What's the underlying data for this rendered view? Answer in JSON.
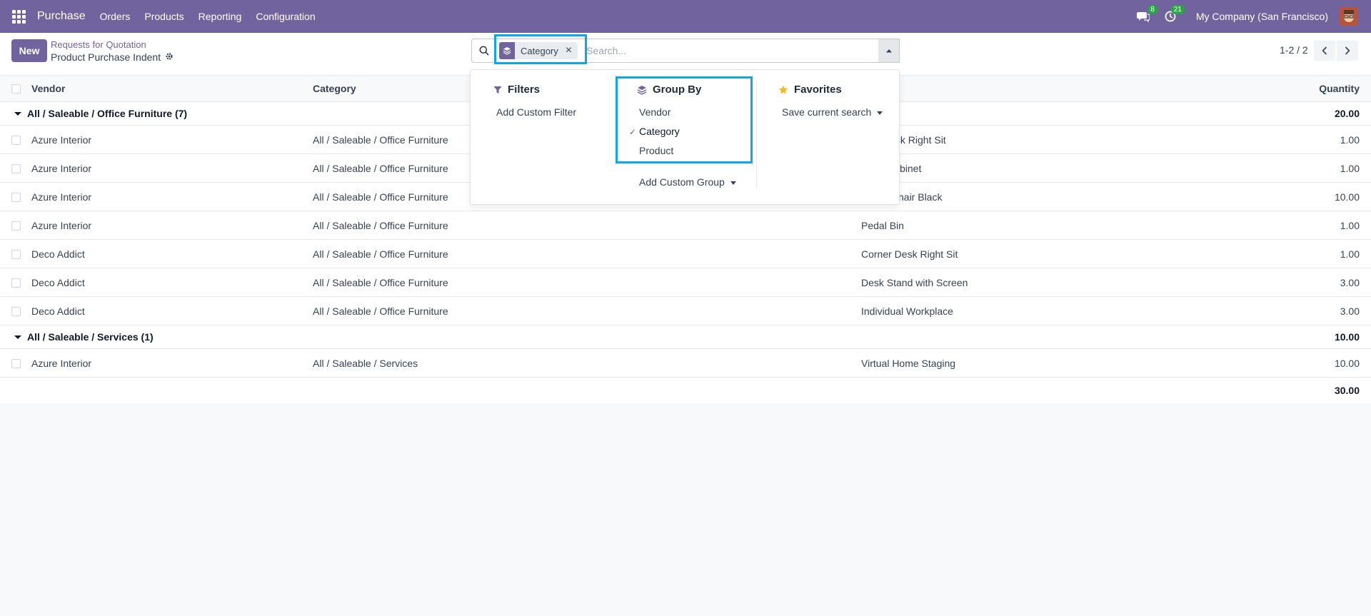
{
  "navbar": {
    "app_name": "Purchase",
    "menu": [
      "Orders",
      "Products",
      "Reporting",
      "Configuration"
    ],
    "messages_count": "8",
    "activities_count": "21",
    "company": "My Company (San Francisco)"
  },
  "control": {
    "new_label": "New",
    "breadcrumb_parent": "Requests for Quotation",
    "breadcrumb_current": "Product Purchase Indent",
    "facet_label": "Category",
    "search_placeholder": "Search...",
    "pager": "1-2 / 2"
  },
  "table": {
    "columns": {
      "vendor": "Vendor",
      "category": "Category",
      "quantity": "Quantity"
    },
    "groups": [
      {
        "label": "All / Saleable / Office Furniture (7)",
        "total": "20.00",
        "rows": [
          {
            "vendor": "Azure Interior",
            "category": "All / Saleable / Office Furniture",
            "product": "Desk Right Sit",
            "qty": "1.00"
          },
          {
            "vendor": "Azure Interior",
            "category": "All / Saleable / Office Furniture",
            "product": "binet",
            "qty": "1.00"
          },
          {
            "vendor": "Azure Interior",
            "category": "All / Saleable / Office Furniture",
            "product": "hair Black",
            "qty": "10.00"
          },
          {
            "vendor": "Azure Interior",
            "category": "All / Saleable / Office Furniture",
            "product": "Pedal Bin",
            "qty": "1.00"
          },
          {
            "vendor": "Deco Addict",
            "category": "All / Saleable / Office Furniture",
            "product": "Corner Desk Right Sit",
            "qty": "1.00"
          },
          {
            "vendor": "Deco Addict",
            "category": "All / Saleable / Office Furniture",
            "product": "Desk Stand with Screen",
            "qty": "3.00"
          },
          {
            "vendor": "Deco Addict",
            "category": "All / Saleable / Office Furniture",
            "product": "Individual Workplace",
            "qty": "3.00"
          }
        ]
      },
      {
        "label": "All / Saleable / Services (1)",
        "total": "10.00",
        "rows": [
          {
            "vendor": "Azure Interior",
            "category": "All / Saleable / Services",
            "product": "Virtual Home Staging",
            "qty": "10.00"
          }
        ]
      }
    ],
    "grand_total": "30.00"
  },
  "dropdown": {
    "filters_title": "Filters",
    "add_custom_filter": "Add Custom Filter",
    "groupby_title": "Group By",
    "groupby_options": [
      "Vendor",
      "Category",
      "Product"
    ],
    "groupby_selected": "Category",
    "add_custom_group": "Add Custom Group",
    "favorites_title": "Favorites",
    "save_current_search": "Save current search"
  },
  "colors": {
    "brand": "#71639e",
    "highlight": "#0ea5e9",
    "badge": "#28a745"
  }
}
